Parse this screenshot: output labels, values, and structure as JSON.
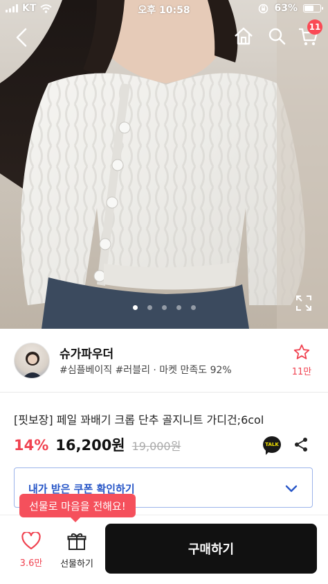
{
  "status_bar": {
    "carrier": "KT",
    "time": "오후 10:58",
    "battery_percent_label": "63%",
    "battery_level": 0.63
  },
  "nav": {
    "cart_count": "11"
  },
  "colors": {
    "accent_red": "#f04250",
    "coupon_blue": "#2655c7",
    "buy_button": "#111111"
  },
  "gallery": {
    "total_slides": 5,
    "active_slide": 1
  },
  "shop": {
    "name": "슈가파우더",
    "tags": "#심플베이직 #러블리 · 마켓 만족도 92%",
    "favorite_count": "11만"
  },
  "product": {
    "title": "[핏보장] 페일 꽈배기 크롭 단추 골지니트 가디건;6col",
    "discount": "14%",
    "price": "16,200원",
    "original_price": "19,000원",
    "talk_label": "TALK"
  },
  "coupon": {
    "label": "내가 받은 쿠폰 확인하기"
  },
  "gift_tooltip": "선물로 마음을 전해요!",
  "bottom_bar": {
    "like_count": "3.6만",
    "gift_label": "선물하기",
    "buy_label": "구매하기"
  },
  "icons": [
    "back-icon",
    "home-icon",
    "search-icon",
    "cart-icon",
    "expand-icon",
    "star-icon",
    "kakao-talk-icon",
    "share-icon",
    "chevron-down-icon",
    "heart-icon",
    "gift-icon"
  ]
}
